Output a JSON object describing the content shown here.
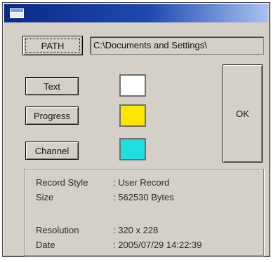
{
  "buttons": {
    "path": "PATH",
    "text": "Text",
    "progress": "Progress",
    "channel": "Channel",
    "ok": "OK"
  },
  "path_field": {
    "value": "C:\\Documents and Settings\\"
  },
  "colors": {
    "text": "#ffffff",
    "progress": "#ffe600",
    "channel": "#20dde0"
  },
  "info": {
    "rows": [
      {
        "label": "Record Style",
        "value": ": User Record"
      },
      {
        "label": "Size",
        "value": ": 562530 Bytes"
      },
      {
        "label": "Resolution",
        "value": ": 320 x 228"
      },
      {
        "label": "Date",
        "value": ": 2005/07/29  14:22:39"
      }
    ]
  },
  "icons": {
    "title": "window-icon"
  }
}
